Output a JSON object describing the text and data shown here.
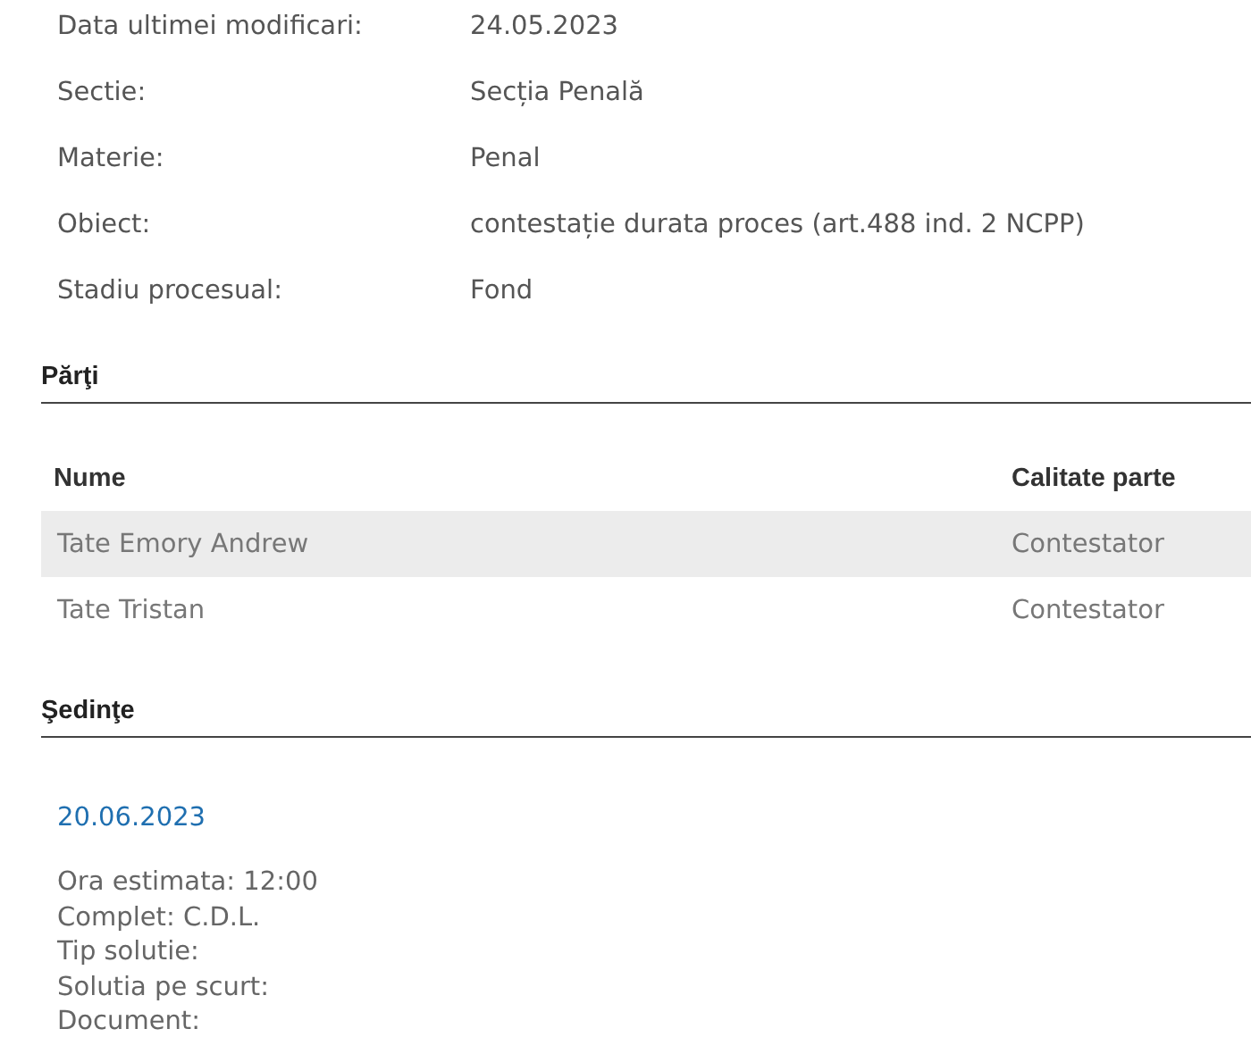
{
  "details": [
    {
      "label": "Data ultimei modificari:",
      "value": "24.05.2023"
    },
    {
      "label": "Sectie:",
      "value": "Secția Penală"
    },
    {
      "label": "Materie:",
      "value": "Penal"
    },
    {
      "label": "Obiect:",
      "value": "contestație durata proces (art.488 ind. 2 NCPP)"
    },
    {
      "label": "Stadiu procesual:",
      "value": "Fond"
    }
  ],
  "parties": {
    "heading": "Părţi",
    "columns": [
      "Nume",
      "Calitate parte"
    ],
    "rows": [
      {
        "name": "Tate Emory Andrew",
        "role": "Contestator",
        "highlighted": true
      },
      {
        "name": "Tate Tristan",
        "role": "Contestator",
        "highlighted": false
      }
    ]
  },
  "hearings": {
    "heading": "Şedinţe",
    "items": [
      {
        "date": "20.06.2023",
        "lines": [
          "Ora estimata: 12:00",
          "Complet: C.D.L.",
          "Tip solutie:",
          "Solutia pe scurt:",
          "Document:"
        ]
      }
    ]
  }
}
